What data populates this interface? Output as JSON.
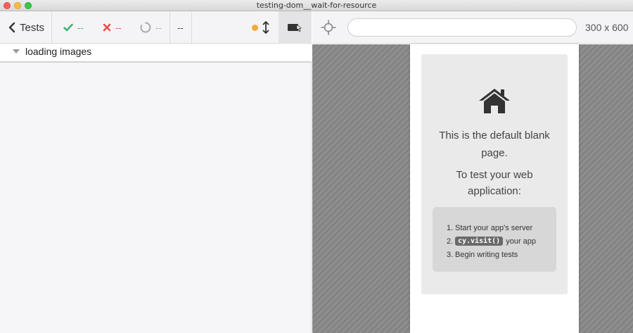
{
  "window": {
    "title": "testing-dom__wait-for-resource"
  },
  "reporter": {
    "tests_label": "Tests",
    "stats": {
      "passed": "--",
      "failed": "--",
      "pending": "--"
    },
    "duration": "--",
    "runnable_title": "loading images"
  },
  "aut": {
    "url_value": "",
    "viewport": "300 x 600",
    "blank_page": {
      "line1": "This is the default blank page.",
      "line2": "To test your web application:",
      "steps": [
        {
          "num": "1.",
          "text": "Start your app's server"
        },
        {
          "num": "2.",
          "code": "cy.visit()",
          "text": "your app"
        },
        {
          "num": "3.",
          "text": "Begin writing tests"
        }
      ]
    }
  },
  "colors": {
    "passed": "#3cb371",
    "failed": "#e94f4f",
    "status_dot": "#f3a93b"
  },
  "icons": [
    "chevron-left-icon",
    "check-icon",
    "x-icon",
    "spinner-icon",
    "scroll-icon",
    "stop-icon",
    "crosshair-icon",
    "home-icon"
  ]
}
